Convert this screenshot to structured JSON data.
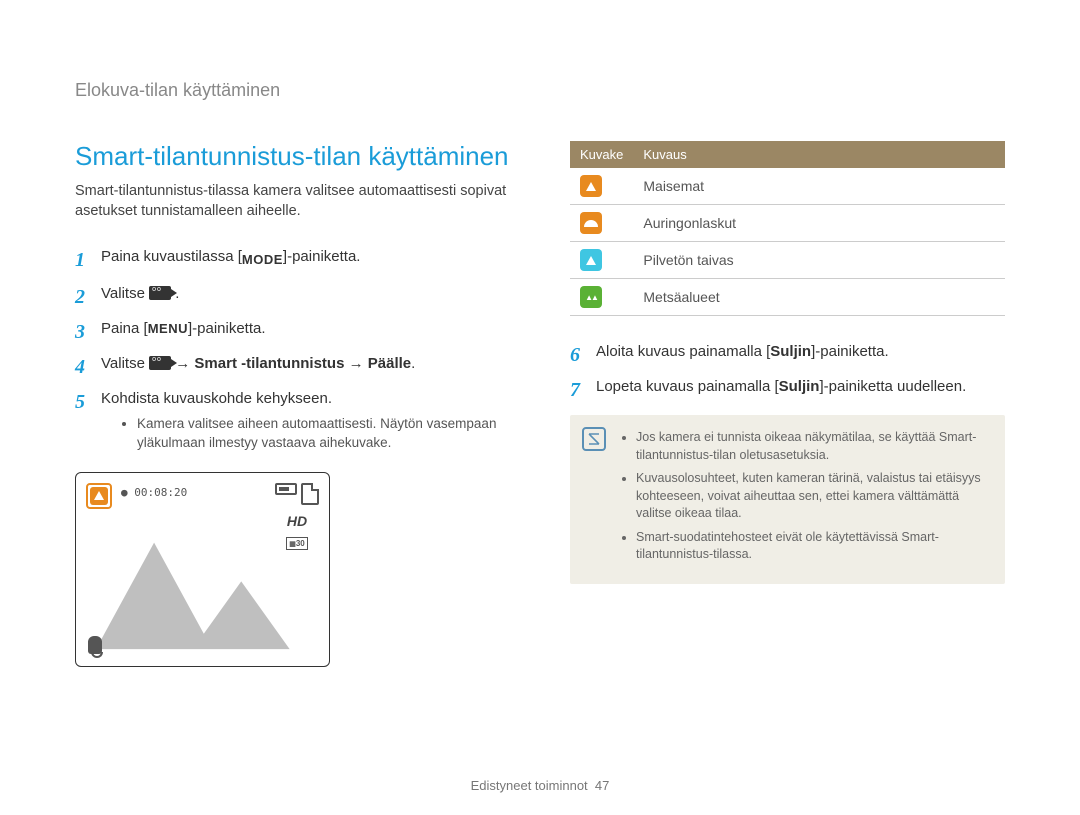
{
  "breadcrumb": "Elokuva-tilan käyttäminen",
  "title": "Smart-tilantunnistus-tilan käyttäminen",
  "intro": "Smart-tilantunnistus-tilassa kamera valitsee automaattisesti sopivat asetukset tunnistamalleen aiheelle.",
  "steps": {
    "s1a": "Paina kuvaustilassa [",
    "s1b": "]-painiketta.",
    "mode_label": "MODE",
    "s2": "Valitse ",
    "s2b": " .",
    "s3a": "Paina [",
    "s3b": "]-painiketta.",
    "menu_label": "MENU",
    "s4a": "Valitse ",
    "s4b": " → ",
    "s4c": "Smart -tilantunnistus",
    "s4d": " → ",
    "s4e": "Päälle",
    "s4f": ".",
    "s5": "Kohdista kuvauskohde kehykseen.",
    "s5sub": "Kamera valitsee aiheen automaattisesti. Näytön vasempaan yläkulmaan ilmestyy vastaava aihekuvake.",
    "s6a": "Aloita kuvaus painamalla [",
    "s6b": "Suljin",
    "s6c": "]-painiketta.",
    "s7a": "Lopeta kuvaus painamalla [",
    "s7b": "Suljin",
    "s7c": "]-painiketta uudelleen."
  },
  "camera": {
    "timer": "00:08:20",
    "hd": "HD",
    "res": "30"
  },
  "table": {
    "h1": "Kuvake",
    "h2": "Kuvaus",
    "rows": [
      {
        "label": "Maisemat"
      },
      {
        "label": "Auringonlaskut"
      },
      {
        "label": "Pilvetön taivas"
      },
      {
        "label": "Metsäalueet"
      }
    ]
  },
  "notes": [
    "Jos kamera ei tunnista oikeaa näkymätilaa, se käyttää Smart-tilantunnistus-tilan oletusasetuksia.",
    "Kuvausolosuhteet, kuten kameran tärinä, valaistus tai etäisyys kohteeseen, voivat aiheuttaa sen, ettei kamera välttämättä valitse oikeaa tilaa.",
    "Smart-suodatintehosteet eivät ole käytettävissä Smart-tilantunnistus-tilassa."
  ],
  "footer": {
    "section": "Edistyneet toiminnot",
    "page": "47"
  }
}
